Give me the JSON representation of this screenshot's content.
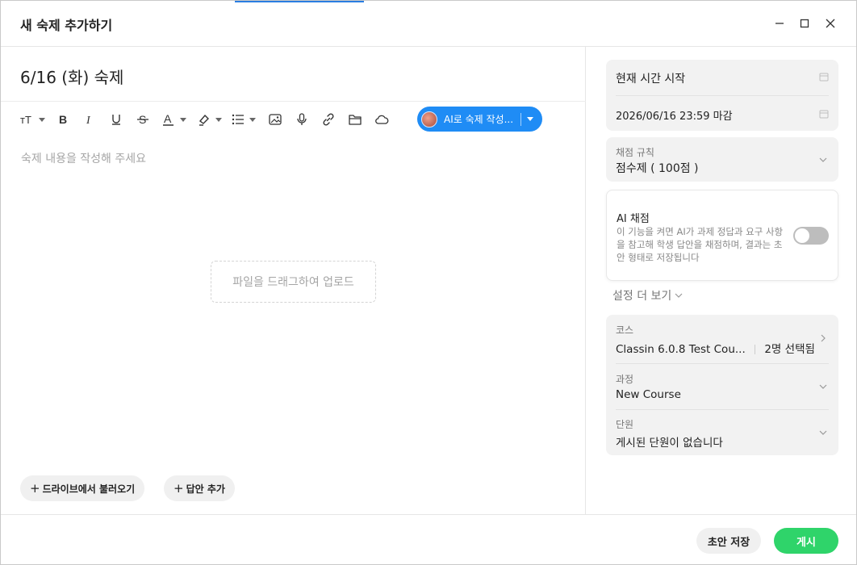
{
  "window": {
    "title": "새 숙제 추가하기",
    "controls": [
      "minimize-icon",
      "maximize-icon",
      "close-icon"
    ]
  },
  "editor": {
    "homework_title": "6/16 (화) 숙제",
    "placeholder": "숙제 내용을 작성해 주세요",
    "dropzone_text": "파일을 드래그하여 업로드",
    "toolbar": {
      "icons": [
        "font-size-icon",
        "bold-icon",
        "italic-icon",
        "underline-icon",
        "strikethrough-icon",
        "text-color-icon",
        "highlight-icon",
        "list-icon",
        "image-icon",
        "microphone-icon",
        "link-icon",
        "folder-icon",
        "cloud-icon"
      ],
      "ai_button_label": "AI로 숙제 작성..."
    },
    "bottom_buttons": {
      "drive_label": "드라이브에서 불러오기",
      "answer_label": "답안 추가"
    }
  },
  "settings": {
    "start_time": "현재 시간 시작",
    "deadline": "2026/06/16 23:59 마감",
    "grading": {
      "label": "채점 규칙",
      "value": "점수제 ( 100점 )"
    },
    "ai_grading": {
      "title": "AI 채점",
      "description": "이 기능을 켜면 AI가 과제 정답과 요구 사항을 참고해 학생 답안을 채점하며, 결과는 초안 형태로 저장됩니다",
      "enabled": false
    },
    "more_settings": "설정 더 보기",
    "course": {
      "label": "코스",
      "value": "Classin 6.0.8 Test Cou...",
      "selected": "2명 선택됨"
    },
    "process": {
      "label": "과정",
      "value": "New Course"
    },
    "unit": {
      "label": "단원",
      "value": "게시된 단원이 없습니다"
    }
  },
  "footer": {
    "draft_label": "초안 저장",
    "publish_label": "게시"
  },
  "colors": {
    "accent_blue": "#1f8cf5",
    "publish_green": "#2fd46a"
  }
}
